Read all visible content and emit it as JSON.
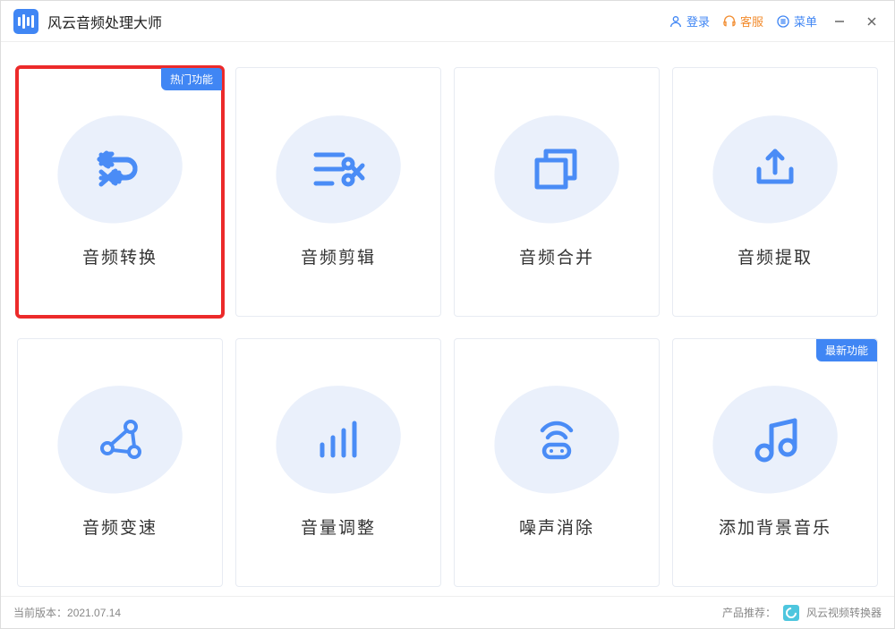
{
  "app": {
    "title": "风云音频处理大师"
  },
  "titlebar": {
    "login": "登录",
    "support": "客服",
    "menu": "菜单"
  },
  "badges": {
    "hot": "热门功能",
    "new": "最新功能"
  },
  "cards": [
    {
      "label": "音频转换"
    },
    {
      "label": "音频剪辑"
    },
    {
      "label": "音频合并"
    },
    {
      "label": "音频提取"
    },
    {
      "label": "音频变速"
    },
    {
      "label": "音量调整"
    },
    {
      "label": "噪声消除"
    },
    {
      "label": "添加背景音乐"
    }
  ],
  "footer": {
    "version_label": "当前版本：",
    "version": "2021.07.14",
    "recommend_label": "产品推荐：",
    "recommend": "风云视频转换器"
  }
}
